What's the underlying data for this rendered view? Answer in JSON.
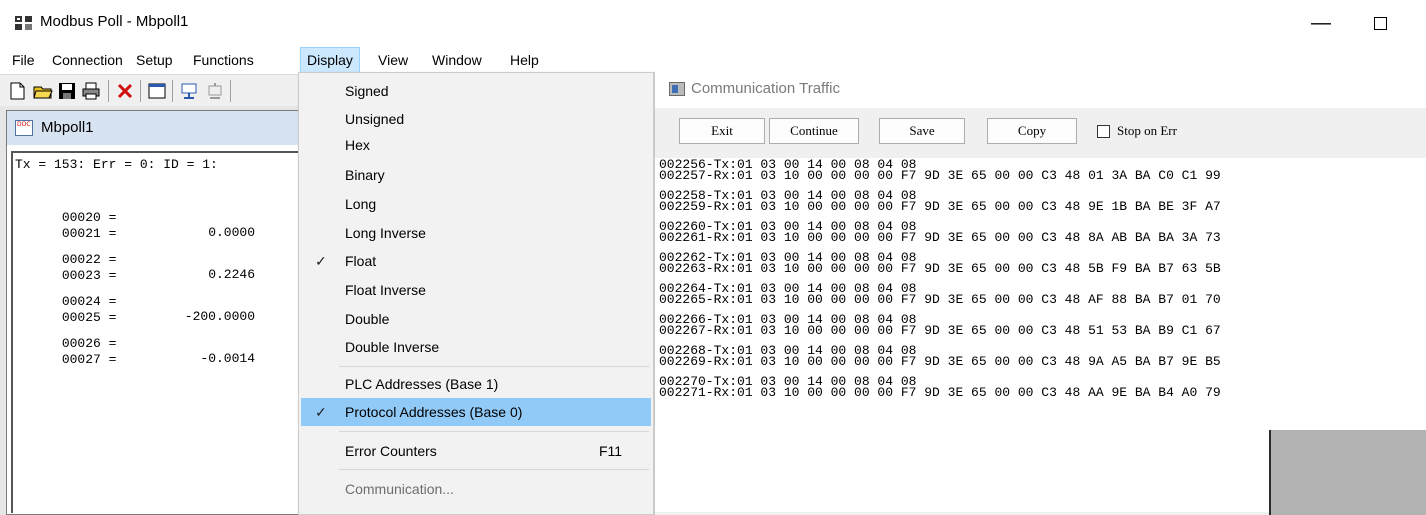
{
  "window": {
    "title": "Modbus Poll - Mbpoll1"
  },
  "menubar": {
    "items": [
      "File",
      "Connection",
      "Setup",
      "Functions",
      "Display",
      "View",
      "Window",
      "Help"
    ],
    "active": "Display"
  },
  "mbpoll": {
    "title": "Mbpoll1",
    "status": "Tx = 153: Err = 0: ID = 1:",
    "registers": [
      {
        "addr": "00020 =",
        "value": "0.0000"
      },
      {
        "addr": "00021 =",
        "value": ""
      },
      {
        "addr": "00022 =",
        "value": "0.2246"
      },
      {
        "addr": "00023 =",
        "value": ""
      },
      {
        "addr": "00024 =",
        "value": "-200.0000"
      },
      {
        "addr": "00025 =",
        "value": ""
      },
      {
        "addr": "00026 =",
        "value": "-0.0014"
      },
      {
        "addr": "00027 =",
        "value": ""
      }
    ]
  },
  "display_menu": {
    "items": [
      {
        "label": "Signed",
        "checked": false
      },
      {
        "label": "Unsigned",
        "checked": false
      },
      {
        "label": "Hex",
        "checked": false
      },
      {
        "label": "Binary",
        "checked": false
      },
      {
        "label": "Long",
        "checked": false
      },
      {
        "label": "Long Inverse",
        "checked": false
      },
      {
        "label": "Float",
        "checked": true
      },
      {
        "label": "Float Inverse",
        "checked": false
      },
      {
        "label": "Double",
        "checked": false
      },
      {
        "label": "Double Inverse",
        "checked": false
      },
      {
        "label": "PLC Addresses (Base 1)",
        "checked": false
      },
      {
        "label": "Protocol Addresses (Base 0)",
        "checked": true,
        "highlighted": true
      },
      {
        "label": "Error Counters",
        "shortcut": "F11"
      },
      {
        "label": "Communication...",
        "disabled": true
      }
    ],
    "check_glyph": "✓"
  },
  "traffic": {
    "title": "Communication Traffic",
    "buttons": {
      "exit": "Exit",
      "continue": "Continue",
      "save": "Save",
      "copy": "Copy"
    },
    "stop_on_err_label": "Stop on Err",
    "stop_on_err_checked": false,
    "lines": [
      "002256-Tx:01 03 00 14 00 08 04 08",
      "002257-Rx:01 03 10 00 00 00 00 F7 9D 3E 65 00 00 C3 48 01 3A BA C0 C1 99",
      "002258-Tx:01 03 00 14 00 08 04 08",
      "002259-Rx:01 03 10 00 00 00 00 F7 9D 3E 65 00 00 C3 48 9E 1B BA BE 3F A7",
      "002260-Tx:01 03 00 14 00 08 04 08",
      "002261-Rx:01 03 10 00 00 00 00 F7 9D 3E 65 00 00 C3 48 8A AB BA BA 3A 73",
      "002262-Tx:01 03 00 14 00 08 04 08",
      "002263-Rx:01 03 10 00 00 00 00 F7 9D 3E 65 00 00 C3 48 5B F9 BA B7 63 5B",
      "002264-Tx:01 03 00 14 00 08 04 08",
      "002265-Rx:01 03 10 00 00 00 00 F7 9D 3E 65 00 00 C3 48 AF 88 BA B7 01 70",
      "002266-Tx:01 03 00 14 00 08 04 08",
      "002267-Rx:01 03 10 00 00 00 00 F7 9D 3E 65 00 00 C3 48 51 53 BA B9 C1 67",
      "002268-Tx:01 03 00 14 00 08 04 08",
      "002269-Rx:01 03 10 00 00 00 00 F7 9D 3E 65 00 00 C3 48 9A A5 BA B7 9E B5",
      "002270-Tx:01 03 00 14 00 08 04 08",
      "002271-Rx:01 03 10 00 00 00 00 F7 9D 3E 65 00 00 C3 48 AA 9E BA B4 A0 79"
    ]
  },
  "colors": {
    "menu_active_bg": "#cce8ff",
    "menu_highlight_bg": "#91c9f7",
    "disabled_text": "#6d6d6d"
  }
}
